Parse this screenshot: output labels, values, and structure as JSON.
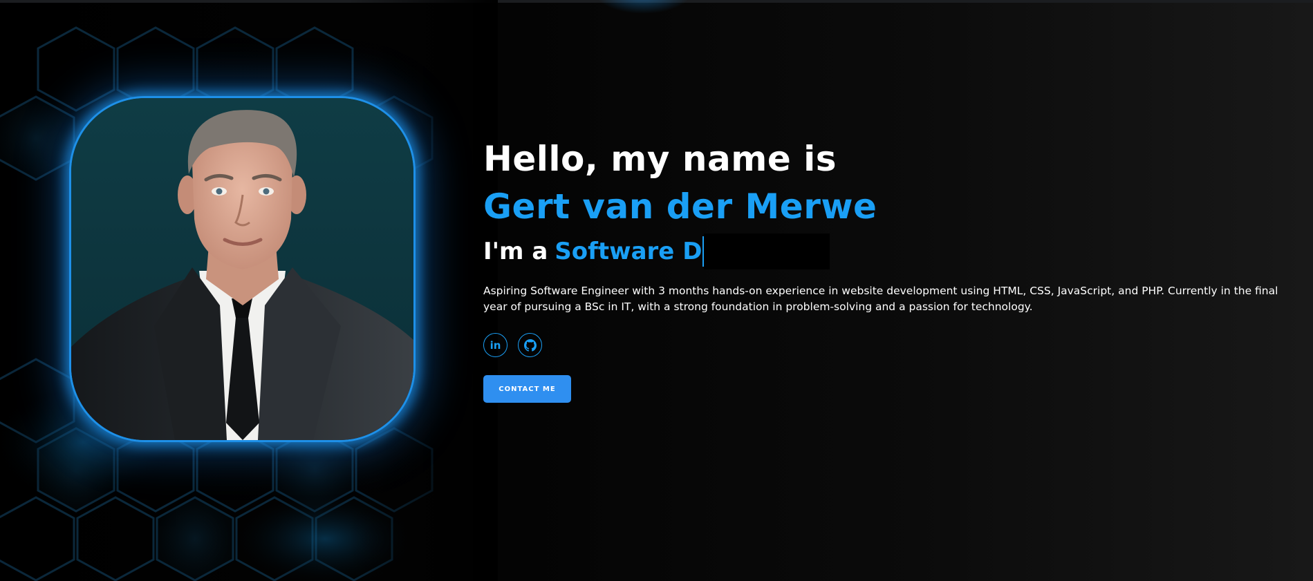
{
  "hero": {
    "greeting": "Hello, my name is",
    "name": "Gert van der Merwe",
    "role_prefix": "I'm a",
    "role_typed": "Software D",
    "bio": "Aspiring Software Engineer with 3 months hands-on experience in website development using HTML, CSS, JavaScript, and PHP. Currently in the final year of pursuing a BSc in IT, with a strong foundation in problem-solving and a passion for technology."
  },
  "socials": {
    "linkedin_icon": "linkedin-icon",
    "linkedin_glyph": "in",
    "github_icon": "github-icon"
  },
  "cta": {
    "contact_label": "CONTACT ME"
  },
  "colors": {
    "accent": "#1a9ff5",
    "button": "#2f8ff0",
    "background": "#000000",
    "portrait_bg": "#0f3840"
  }
}
